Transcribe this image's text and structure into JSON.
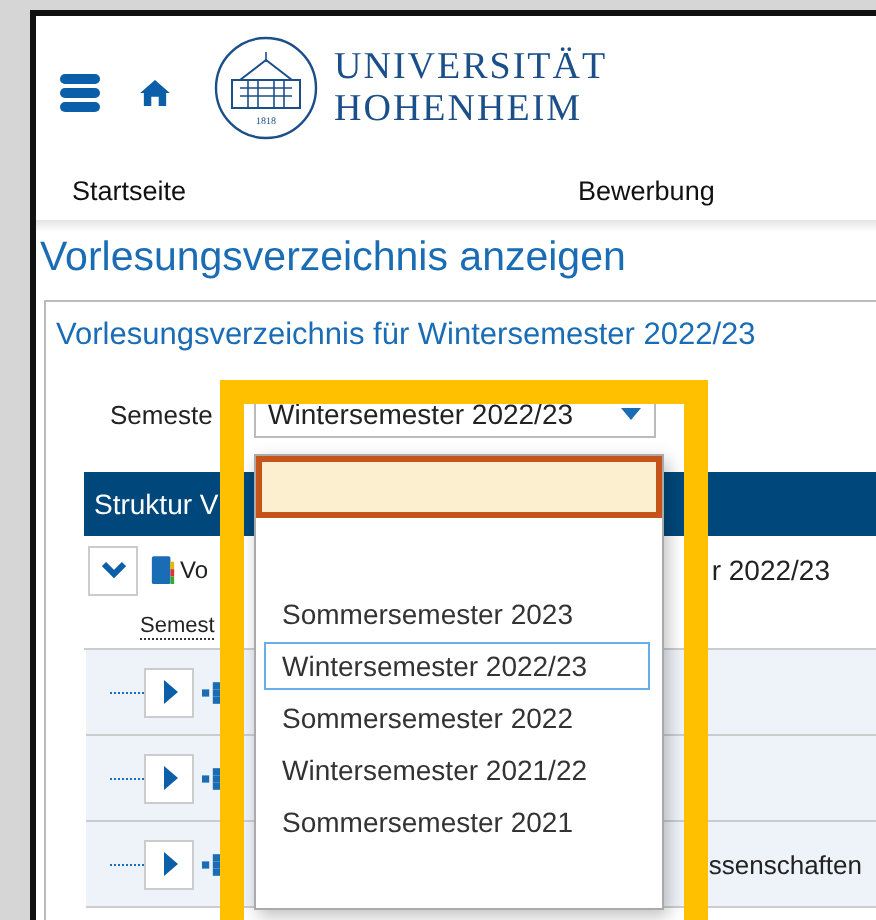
{
  "header": {
    "logo_lines": [
      "UNIVERSITÄT",
      "HOHENHEIM"
    ],
    "seal_year": "1818"
  },
  "nav": [
    "Startseite",
    "Bewerbung"
  ],
  "page_title": "Vorlesungsverzeichnis anzeigen",
  "panel": {
    "title": "Vorlesungsverzeichnis für Wintersemester 2022/23",
    "semester_label": "Semeste",
    "semester_select": {
      "value": "Wintersemester 2022/23"
    },
    "table_header": "Struktur V",
    "tree": {
      "expanded": true,
      "text_start": "Vo",
      "text_end": "r 2022/23",
      "link": "Semest",
      "children": [
        {
          "expanded": false
        },
        {
          "expanded": false
        },
        {
          "expanded": false,
          "text_end": "ssenschaften"
        }
      ]
    }
  },
  "dropdown": {
    "blank_option": {
      "highlighted": true
    },
    "options": [
      {
        "label": "Sommersemester 2023",
        "selected": false
      },
      {
        "label": "Wintersemester 2022/23",
        "selected": true
      },
      {
        "label": "Sommersemester 2022",
        "selected": false
      },
      {
        "label": "Wintersemester 2021/22",
        "selected": false
      },
      {
        "label": "Sommersemester 2021",
        "selected": false
      }
    ]
  },
  "annotation": {
    "highlight_frame": true
  }
}
